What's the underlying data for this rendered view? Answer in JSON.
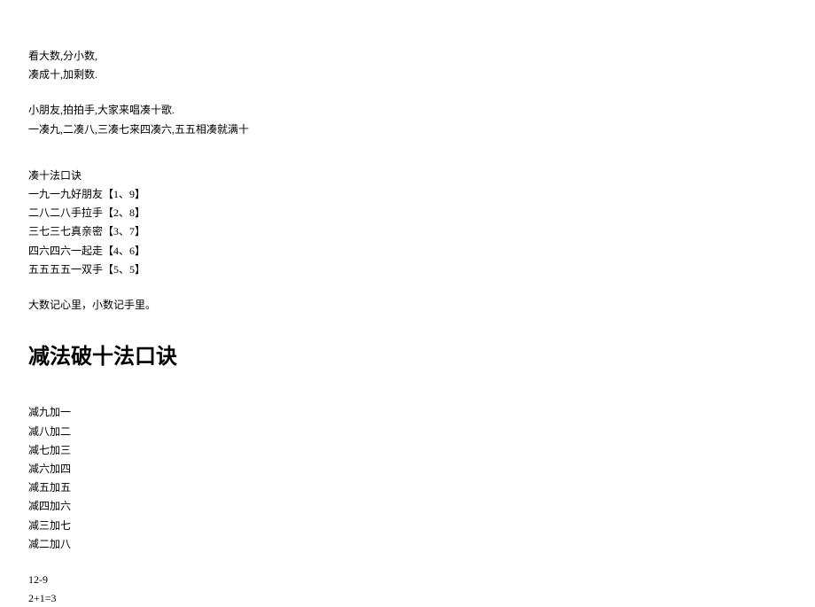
{
  "section1": {
    "line1": "看大数,分小数,",
    "line2": "凑成十,加剩数."
  },
  "section2": {
    "line1": "小朋友,拍拍手,大家来唱凑十歌.",
    "line2": "一凑九,二凑八,三凑七来四凑六,五五相凑就满十"
  },
  "section3": {
    "title": "凑十法口诀",
    "rules": [
      "一九一九好朋友【1、9】",
      "二八二八手拉手【2、8】",
      "三七三七真亲密【3、7】",
      "四六四六一起走【4、6】",
      "五五五五一双手【5、5】"
    ]
  },
  "memoryTip": "大数记心里，小数记手里。",
  "heading": "减法破十法口诀",
  "subtractionRules": [
    "减九加一",
    "减八加二",
    "减七加三",
    "减六加四",
    "减五加五",
    "减四加六",
    "减三加七",
    "减二加八"
  ],
  "example": {
    "line1": "12-9",
    "line2": "2+1=3"
  }
}
